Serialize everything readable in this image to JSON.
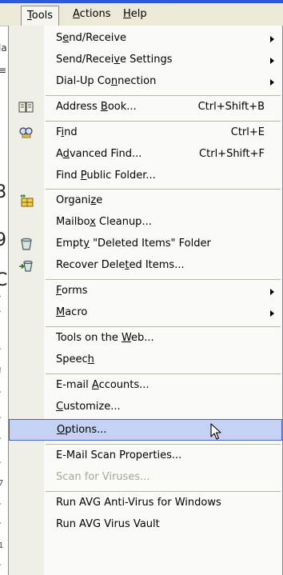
{
  "menubar": {
    "tools": {
      "label": "Tools",
      "mnemonic": "T",
      "rest": "ools"
    },
    "actions": {
      "label": "Actions",
      "mnemonic": "A",
      "rest": "ctions"
    },
    "help": {
      "label": "Help",
      "mnemonic": "H",
      "rest": "elp"
    }
  },
  "left_fragments": [
    "la",
    "≡",
    "8",
    "9",
    "C",
    "(",
    "-",
    "!",
    "-",
    "-",
    "-",
    "-",
    "7",
    "-",
    "-",
    "1",
    "-"
  ],
  "menu": {
    "items": [
      {
        "pre": "S",
        "mn": "e",
        "post": "nd/Receive",
        "shortcut": "",
        "submenu": true,
        "icon": ""
      },
      {
        "pre": "Send/Recei",
        "mn": "v",
        "post": "e Settings",
        "shortcut": "",
        "submenu": true,
        "icon": ""
      },
      {
        "pre": "Dial-Up Co",
        "mn": "n",
        "post": "nection",
        "shortcut": "",
        "submenu": true,
        "icon": ""
      },
      {
        "pre": "Address ",
        "mn": "B",
        "post": "ook...",
        "shortcut": "Ctrl+Shift+B",
        "submenu": false,
        "icon": "address-book-icon"
      },
      {
        "pre": "F",
        "mn": "i",
        "post": "nd",
        "shortcut": "Ctrl+E",
        "submenu": false,
        "icon": "find-icon"
      },
      {
        "pre": "A",
        "mn": "d",
        "post": "vanced Find...",
        "shortcut": "Ctrl+Shift+F",
        "submenu": false,
        "icon": ""
      },
      {
        "pre": "Find ",
        "mn": "P",
        "post": "ublic Folder...",
        "shortcut": "",
        "submenu": false,
        "icon": ""
      },
      {
        "pre": "Organi",
        "mn": "z",
        "post": "e",
        "shortcut": "",
        "submenu": false,
        "icon": "organize-icon"
      },
      {
        "pre": "Mailbo",
        "mn": "x",
        "post": " Cleanup...",
        "shortcut": "",
        "submenu": false,
        "icon": ""
      },
      {
        "pre": "Empt",
        "mn": "y",
        "post": " \"Deleted Items\" Folder",
        "shortcut": "",
        "submenu": false,
        "icon": "empty-trash-icon"
      },
      {
        "pre": "Recover Dele",
        "mn": "t",
        "post": "ed Items...",
        "shortcut": "",
        "submenu": false,
        "icon": "recover-icon"
      },
      {
        "pre": "",
        "mn": "F",
        "post": "orms",
        "shortcut": "",
        "submenu": true,
        "icon": ""
      },
      {
        "pre": "",
        "mn": "M",
        "post": "acro",
        "shortcut": "",
        "submenu": true,
        "icon": ""
      },
      {
        "pre": "Tools on the ",
        "mn": "W",
        "post": "eb...",
        "shortcut": "",
        "submenu": false,
        "icon": ""
      },
      {
        "pre": "Speec",
        "mn": "h",
        "post": "",
        "shortcut": "",
        "submenu": false,
        "icon": ""
      },
      {
        "pre": "E-mail ",
        "mn": "A",
        "post": "ccounts...",
        "shortcut": "",
        "submenu": false,
        "icon": ""
      },
      {
        "pre": "",
        "mn": "C",
        "post": "ustomize...",
        "shortcut": "",
        "submenu": false,
        "icon": ""
      },
      {
        "pre": "",
        "mn": "O",
        "post": "ptions...",
        "shortcut": "",
        "submenu": false,
        "icon": "",
        "highlighted": true
      },
      {
        "pre": "E-Mail Scan Properties...",
        "mn": "",
        "post": "",
        "shortcut": "",
        "submenu": false,
        "icon": ""
      },
      {
        "pre": "Scan for Viruses...",
        "mn": "",
        "post": "",
        "shortcut": "",
        "submenu": false,
        "icon": "",
        "disabled": true
      },
      {
        "pre": "Run AVG Anti-Virus for Windows",
        "mn": "",
        "post": "",
        "shortcut": "",
        "submenu": false,
        "icon": ""
      },
      {
        "pre": "Run AVG Virus Vault",
        "mn": "",
        "post": "",
        "shortcut": "",
        "submenu": false,
        "icon": ""
      }
    ]
  },
  "colors": {
    "highlight_bg": "#c4d3f4",
    "highlight_border": "#3b68c8",
    "disabled_text": "#a6a69a",
    "menubar_bg": "#ece9d8"
  }
}
